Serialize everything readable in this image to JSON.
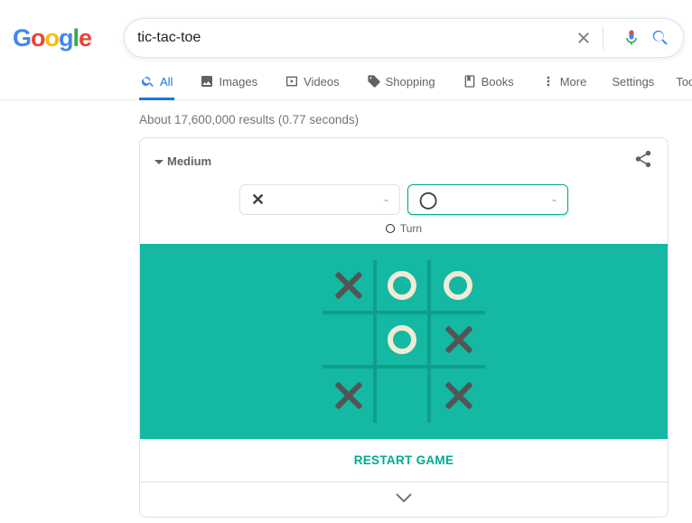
{
  "search": {
    "query": "tic-tac-toe"
  },
  "nav": {
    "all": "All",
    "images": "Images",
    "videos": "Videos",
    "shopping": "Shopping",
    "books": "Books",
    "more": "More",
    "settings": "Settings",
    "tools": "Tools"
  },
  "stats": "About 17,600,000 results (0.77 seconds)",
  "game": {
    "difficulty": "Medium",
    "playerX": {
      "symbol": "✕",
      "score": "-"
    },
    "playerO": {
      "symbol": "◯",
      "score": "-"
    },
    "turn_label": "Turn",
    "restart": "RESTART GAME",
    "board": [
      "X",
      "O",
      "O",
      "",
      "O",
      "X",
      "X",
      "",
      "X"
    ]
  }
}
